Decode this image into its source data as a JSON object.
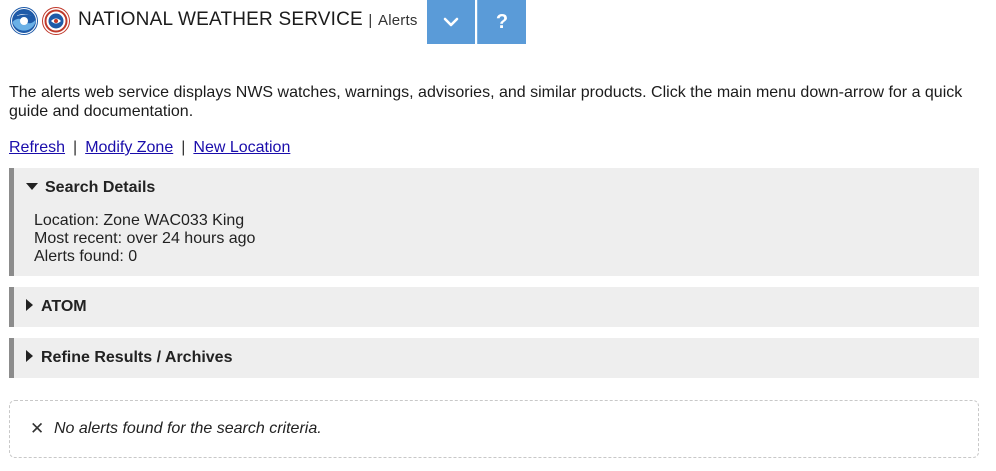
{
  "header": {
    "brand_title": "NATIONAL WEATHER SERVICE",
    "separator": "|",
    "section": "Alerts",
    "menu_icon": "chevron-down-icon",
    "help_label": "?",
    "accent_color": "#5a9bd8"
  },
  "intro": {
    "text": "The alerts web service displays NWS watches, warnings, advisories, and similar products. Click the main menu down-arrow for a quick guide and documentation."
  },
  "links": {
    "refresh": "Refresh",
    "modify_zone": "Modify Zone",
    "new_location": "New Location",
    "separator": "|"
  },
  "search_details": {
    "title": "Search Details",
    "location": "Location: Zone WAC033 King",
    "most_recent": "Most recent: over 24 hours ago",
    "alerts_found": "Alerts found: 0"
  },
  "atom": {
    "title": "ATOM"
  },
  "refine": {
    "title": "Refine Results / Archives"
  },
  "result": {
    "icon": "close-icon",
    "message": "No alerts found for the search criteria."
  }
}
